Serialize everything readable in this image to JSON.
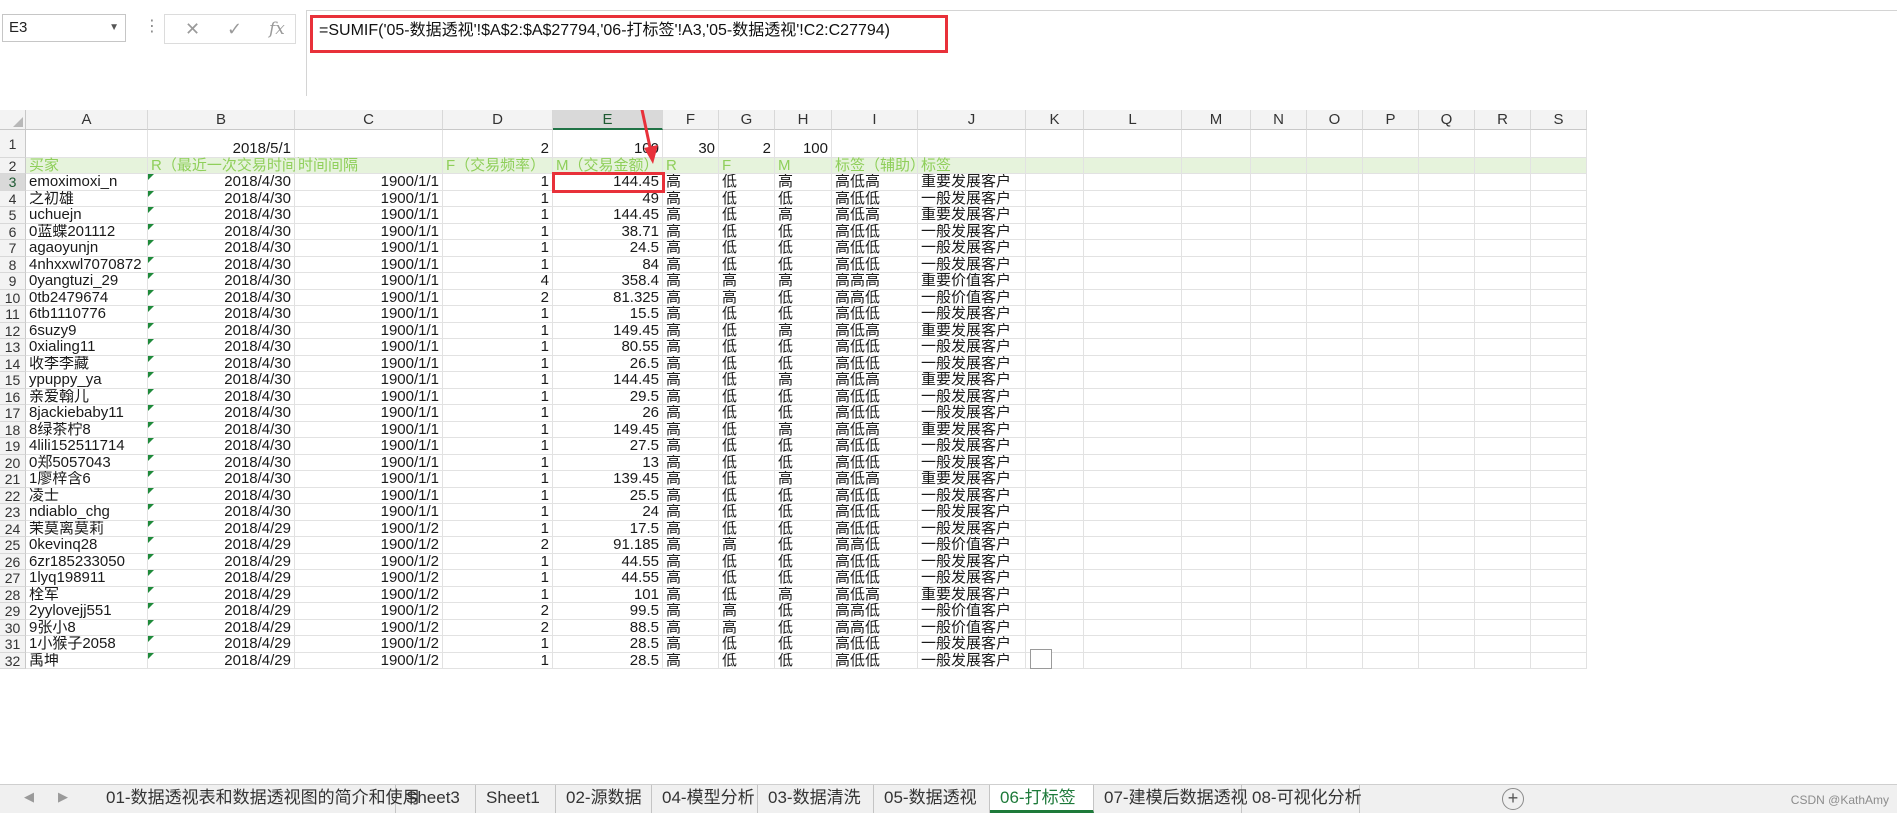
{
  "formula_bar": {
    "name_box": "E3",
    "cancel_symbol": "✕",
    "enter_symbol": "✓",
    "fx_symbol": "fx",
    "formula": "=SUMIF('05-数据透视'!$A$2:$A$27794,'06-打标签'!A3,'05-数据透视'!C2:C27794)"
  },
  "columns": [
    "A",
    "B",
    "C",
    "D",
    "E",
    "F",
    "G",
    "H",
    "I",
    "J",
    "K",
    "L",
    "M",
    "N",
    "O",
    "P",
    "Q",
    "R",
    "S"
  ],
  "selected_column": "E",
  "selected_cell": "E3",
  "row1": {
    "B": "2018/5/1",
    "D": "2",
    "E": "100",
    "F": "30",
    "G": "2",
    "H": "100"
  },
  "headers": {
    "A": "买家",
    "B": "R（最近一次交易时间）",
    "C": "时间间隔",
    "D": "F（交易频率）",
    "E": "M（交易金额）",
    "F": "R",
    "G": "F",
    "H": "M",
    "I": "标签（辅助）",
    "J": "标签"
  },
  "rows": [
    [
      "emoximoxi_n",
      "2018/4/30",
      "1900/1/1",
      "1",
      "144.45",
      "高",
      "低",
      "高",
      "高低高",
      "重要发展客户"
    ],
    [
      "之初雄",
      "2018/4/30",
      "1900/1/1",
      "1",
      "49",
      "高",
      "低",
      "低",
      "高低低",
      "一般发展客户"
    ],
    [
      "uchuejn",
      "2018/4/30",
      "1900/1/1",
      "1",
      "144.45",
      "高",
      "低",
      "高",
      "高低高",
      "重要发展客户"
    ],
    [
      "0蓝蝶201112",
      "2018/4/30",
      "1900/1/1",
      "1",
      "38.71",
      "高",
      "低",
      "低",
      "高低低",
      "一般发展客户"
    ],
    [
      "agaoyunjn",
      "2018/4/30",
      "1900/1/1",
      "1",
      "24.5",
      "高",
      "低",
      "低",
      "高低低",
      "一般发展客户"
    ],
    [
      "4nhxxwl7070872",
      "2018/4/30",
      "1900/1/1",
      "1",
      "84",
      "高",
      "低",
      "低",
      "高低低",
      "一般发展客户"
    ],
    [
      "0yangtuzi_29",
      "2018/4/30",
      "1900/1/1",
      "4",
      "358.4",
      "高",
      "高",
      "高",
      "高高高",
      "重要价值客户"
    ],
    [
      "0tb2479674",
      "2018/4/30",
      "1900/1/1",
      "2",
      "81.325",
      "高",
      "高",
      "低",
      "高高低",
      "一般价值客户"
    ],
    [
      "6tb1110776",
      "2018/4/30",
      "1900/1/1",
      "1",
      "15.5",
      "高",
      "低",
      "低",
      "高低低",
      "一般发展客户"
    ],
    [
      "6suzy9",
      "2018/4/30",
      "1900/1/1",
      "1",
      "149.45",
      "高",
      "低",
      "高",
      "高低高",
      "重要发展客户"
    ],
    [
      "0xialing11",
      "2018/4/30",
      "1900/1/1",
      "1",
      "80.55",
      "高",
      "低",
      "低",
      "高低低",
      "一般发展客户"
    ],
    [
      "收李李藏",
      "2018/4/30",
      "1900/1/1",
      "1",
      "26.5",
      "高",
      "低",
      "低",
      "高低低",
      "一般发展客户"
    ],
    [
      "ypuppy_ya",
      "2018/4/30",
      "1900/1/1",
      "1",
      "144.45",
      "高",
      "低",
      "高",
      "高低高",
      "重要发展客户"
    ],
    [
      "亲爱翰儿",
      "2018/4/30",
      "1900/1/1",
      "1",
      "29.5",
      "高",
      "低",
      "低",
      "高低低",
      "一般发展客户"
    ],
    [
      "8jackiebaby11",
      "2018/4/30",
      "1900/1/1",
      "1",
      "26",
      "高",
      "低",
      "低",
      "高低低",
      "一般发展客户"
    ],
    [
      "8绿茶柠8",
      "2018/4/30",
      "1900/1/1",
      "1",
      "149.45",
      "高",
      "低",
      "高",
      "高低高",
      "重要发展客户"
    ],
    [
      "4lili152511714",
      "2018/4/30",
      "1900/1/1",
      "1",
      "27.5",
      "高",
      "低",
      "低",
      "高低低",
      "一般发展客户"
    ],
    [
      "0郑5057043",
      "2018/4/30",
      "1900/1/1",
      "1",
      "13",
      "高",
      "低",
      "低",
      "高低低",
      "一般发展客户"
    ],
    [
      "1廖梓含6",
      "2018/4/30",
      "1900/1/1",
      "1",
      "139.45",
      "高",
      "低",
      "高",
      "高低高",
      "重要发展客户"
    ],
    [
      "凌士",
      "2018/4/30",
      "1900/1/1",
      "1",
      "25.5",
      "高",
      "低",
      "低",
      "高低低",
      "一般发展客户"
    ],
    [
      "ndiablo_chg",
      "2018/4/30",
      "1900/1/1",
      "1",
      "24",
      "高",
      "低",
      "低",
      "高低低",
      "一般发展客户"
    ],
    [
      "茉莫离莫莉",
      "2018/4/29",
      "1900/1/2",
      "1",
      "17.5",
      "高",
      "低",
      "低",
      "高低低",
      "一般发展客户"
    ],
    [
      "0kevinq28",
      "2018/4/29",
      "1900/1/2",
      "2",
      "91.185",
      "高",
      "高",
      "低",
      "高高低",
      "一般价值客户"
    ],
    [
      "6zr185233050",
      "2018/4/29",
      "1900/1/2",
      "1",
      "44.55",
      "高",
      "低",
      "低",
      "高低低",
      "一般发展客户"
    ],
    [
      "1lyq198911",
      "2018/4/29",
      "1900/1/2",
      "1",
      "44.55",
      "高",
      "低",
      "低",
      "高低低",
      "一般发展客户"
    ],
    [
      "栓军",
      "2018/4/29",
      "1900/1/2",
      "1",
      "101",
      "高",
      "低",
      "高",
      "高低高",
      "重要发展客户"
    ],
    [
      "2yylovejj551",
      "2018/4/29",
      "1900/1/2",
      "2",
      "99.5",
      "高",
      "高",
      "低",
      "高高低",
      "一般价值客户"
    ],
    [
      "9张小8",
      "2018/4/29",
      "1900/1/2",
      "2",
      "88.5",
      "高",
      "高",
      "低",
      "高高低",
      "一般价值客户"
    ],
    [
      "1小猴子2058",
      "2018/4/29",
      "1900/1/2",
      "1",
      "28.5",
      "高",
      "低",
      "低",
      "高低低",
      "一般发展客户"
    ],
    [
      "禹坤",
      "2018/4/29",
      "1900/1/2",
      "1",
      "28.5",
      "高",
      "低",
      "低",
      "高低低",
      "一般发展客户"
    ]
  ],
  "sheet_tabs": [
    "01-数据透视表和数据透视图的简介和使用",
    "Sheet3",
    "Sheet1",
    "02-源数据",
    "04-模型分析",
    "03-数据清洗",
    "05-数据透视",
    "06-打标签",
    "07-建模后数据透视",
    "08-可视化分析"
  ],
  "active_tab": "06-打标签",
  "nav_prev": "◀",
  "nav_next": "▶",
  "add_sheet": "+",
  "watermark": "CSDN @KathAmy",
  "colors": {
    "accent_red": "#e8313a",
    "header_green": "#8fcf5a",
    "excel_green": "#1e7a3a"
  }
}
